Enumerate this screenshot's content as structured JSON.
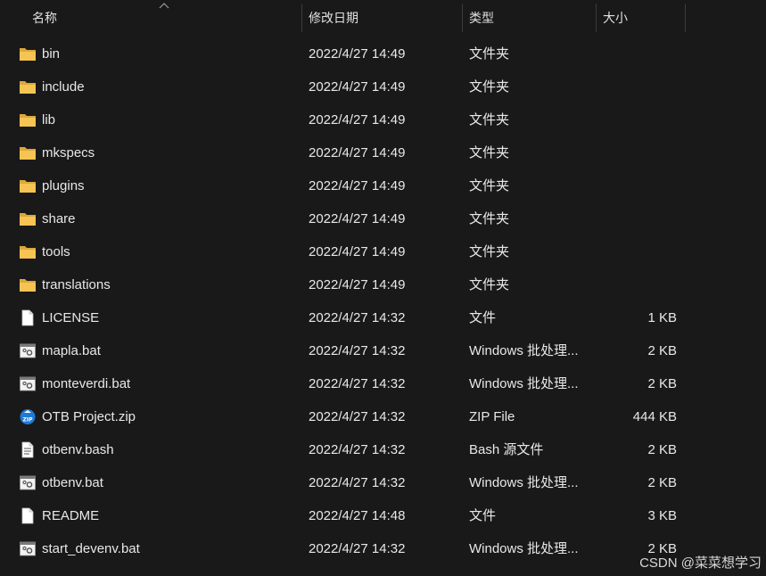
{
  "columns": {
    "name": "名称",
    "modified": "修改日期",
    "type": "类型",
    "size": "大小"
  },
  "files": [
    {
      "name": "bin",
      "modified": "2022/4/27 14:49",
      "type": "文件夹",
      "size": "",
      "icon": "folder-icon"
    },
    {
      "name": "include",
      "modified": "2022/4/27 14:49",
      "type": "文件夹",
      "size": "",
      "icon": "folder-icon"
    },
    {
      "name": "lib",
      "modified": "2022/4/27 14:49",
      "type": "文件夹",
      "size": "",
      "icon": "folder-icon"
    },
    {
      "name": "mkspecs",
      "modified": "2022/4/27 14:49",
      "type": "文件夹",
      "size": "",
      "icon": "folder-icon"
    },
    {
      "name": "plugins",
      "modified": "2022/4/27 14:49",
      "type": "文件夹",
      "size": "",
      "icon": "folder-icon"
    },
    {
      "name": "share",
      "modified": "2022/4/27 14:49",
      "type": "文件夹",
      "size": "",
      "icon": "folder-icon"
    },
    {
      "name": "tools",
      "modified": "2022/4/27 14:49",
      "type": "文件夹",
      "size": "",
      "icon": "folder-icon"
    },
    {
      "name": "translations",
      "modified": "2022/4/27 14:49",
      "type": "文件夹",
      "size": "",
      "icon": "folder-icon"
    },
    {
      "name": "LICENSE",
      "modified": "2022/4/27 14:32",
      "type": "文件",
      "size": "1 KB",
      "icon": "file-icon"
    },
    {
      "name": "mapla.bat",
      "modified": "2022/4/27 14:32",
      "type": "Windows 批处理...",
      "size": "2 KB",
      "icon": "batch-file-icon"
    },
    {
      "name": "monteverdi.bat",
      "modified": "2022/4/27 14:32",
      "type": "Windows 批处理...",
      "size": "2 KB",
      "icon": "batch-file-icon"
    },
    {
      "name": "OTB Project.zip",
      "modified": "2022/4/27 14:32",
      "type": "ZIP File",
      "size": "444 KB",
      "icon": "zip-file-icon"
    },
    {
      "name": "otbenv.bash",
      "modified": "2022/4/27 14:32",
      "type": "Bash 源文件",
      "size": "2 KB",
      "icon": "text-file-icon"
    },
    {
      "name": "otbenv.bat",
      "modified": "2022/4/27 14:32",
      "type": "Windows 批处理...",
      "size": "2 KB",
      "icon": "batch-file-icon"
    },
    {
      "name": "README",
      "modified": "2022/4/27 14:48",
      "type": "文件",
      "size": "3 KB",
      "icon": "file-icon"
    },
    {
      "name": "start_devenv.bat",
      "modified": "2022/4/27 14:32",
      "type": "Windows 批处理...",
      "size": "2 KB",
      "icon": "batch-file-icon"
    }
  ],
  "watermark": "CSDN @菜菜想学习",
  "colors": {
    "background": "#191919",
    "text": "#e8e8e8",
    "folder": "#f2c14e"
  }
}
